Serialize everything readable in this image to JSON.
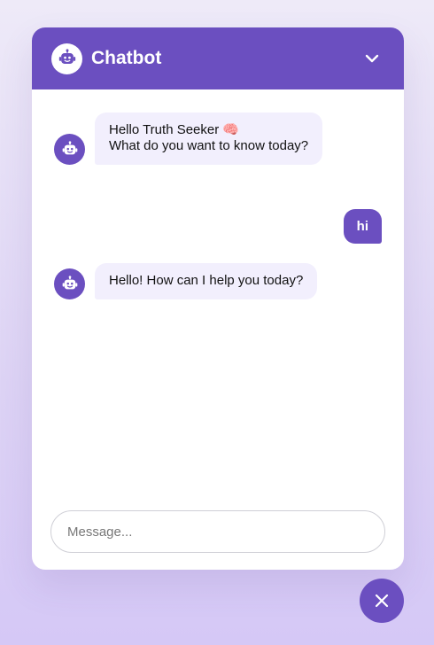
{
  "header": {
    "title": "Chatbot",
    "logo_icon": "robot-icon",
    "collapse_icon": "chevron-down-icon"
  },
  "messages": [
    {
      "sender": "bot",
      "lines": [
        "Hello Truth Seeker 🧠",
        "What do you want to know today?"
      ]
    },
    {
      "sender": "user",
      "text": "hi"
    },
    {
      "sender": "bot",
      "lines": [
        "Hello! How can I help you today?"
      ]
    }
  ],
  "input": {
    "placeholder": "Message...",
    "value": ""
  },
  "toggle": {
    "icon": "close-icon"
  },
  "colors": {
    "accent": "#6b4fc0",
    "bot_bubble": "#f2effd",
    "background": "#e6def7"
  }
}
